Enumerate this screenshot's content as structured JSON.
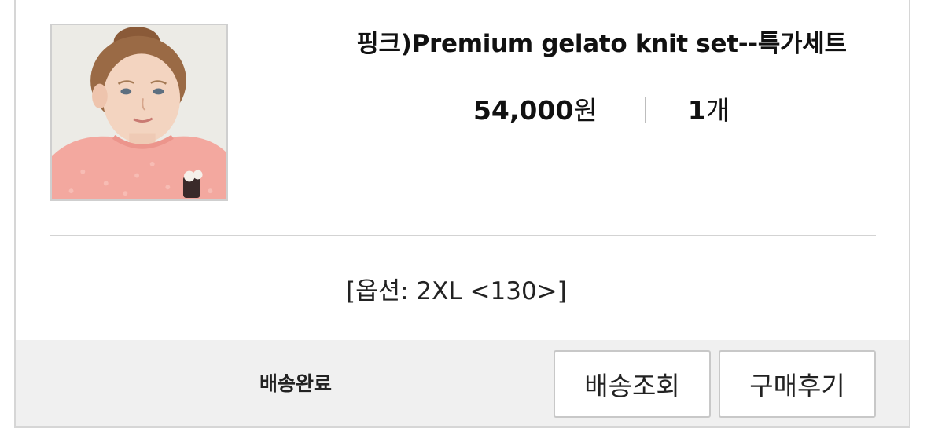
{
  "product": {
    "title": "핑크)Premium gelato knit set--특가세트",
    "price": "54,000",
    "price_unit": "원",
    "quantity": "1",
    "quantity_unit": "개",
    "option": "[옵션: 2XL <130>]"
  },
  "order": {
    "status": "배송완료",
    "track_button": "배송조회",
    "review_button": "구매후기"
  },
  "colors": {
    "footer_bg": "#f0f0f0",
    "divider": "#d3d3d3",
    "sweater": "#f3a89f"
  },
  "icons": {
    "thumbnail": "product-photo-girl-pink-knit"
  }
}
